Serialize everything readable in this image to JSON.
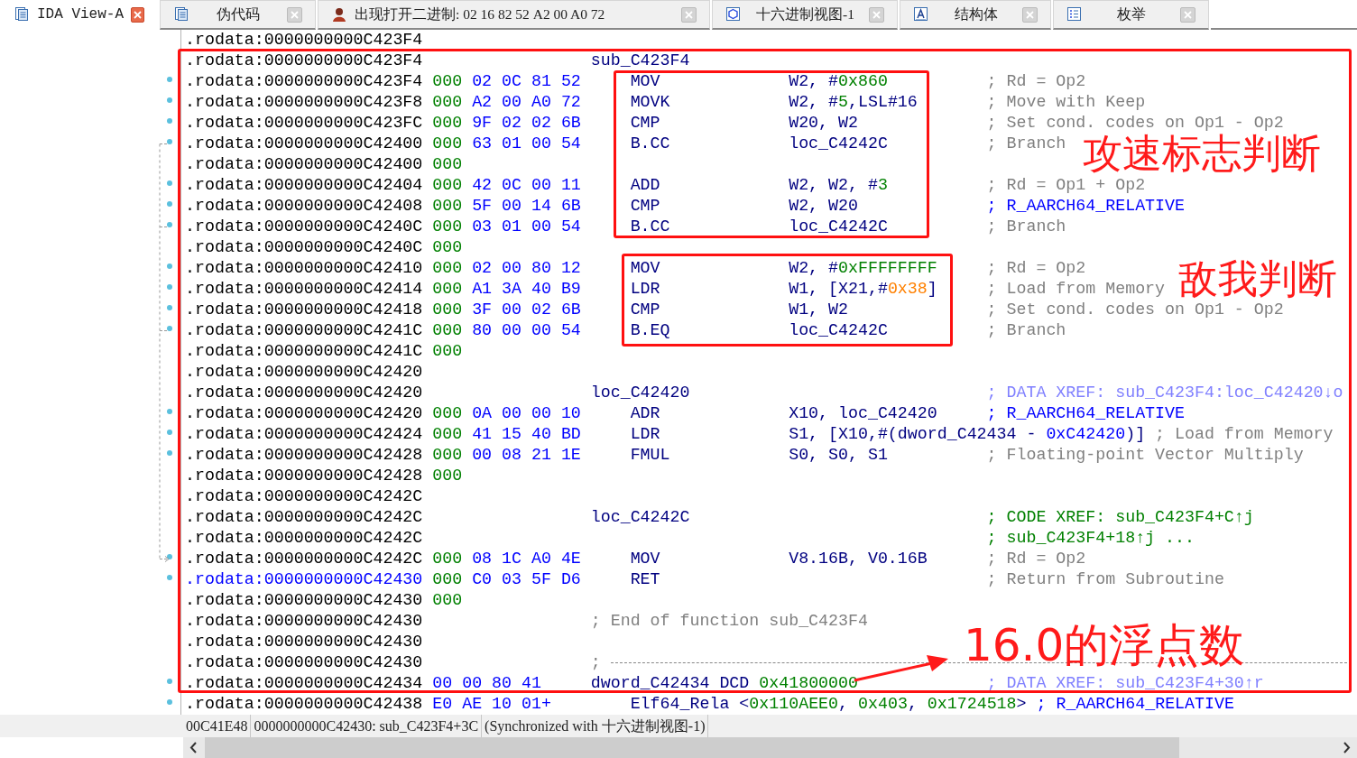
{
  "tabs": [
    {
      "label": "IDA View-A",
      "kind": "listing",
      "selected": true
    },
    {
      "label": "伪代码",
      "kind": "pseudocode",
      "selected": false
    },
    {
      "label": "出现打开二进制: 02 16 82 52 A2 00 A0 72",
      "kind": "custom",
      "selected": false
    },
    {
      "label": "十六进制视图-1",
      "kind": "hex",
      "selected": false
    },
    {
      "label": "结构体",
      "kind": "struct",
      "selected": false
    },
    {
      "label": "枚举",
      "kind": "enum",
      "selected": false
    }
  ],
  "rows": [
    {
      "kind": "addr",
      "addr": ".rodata:0000000000C423F4",
      "marker": false,
      "selected": false
    },
    {
      "kind": "label",
      "addr": ".rodata:0000000000C423F4",
      "label": "sub_C423F4",
      "marker": false,
      "selected": false
    },
    {
      "kind": "insn",
      "addr": ".rodata:0000000000C423F4",
      "prefix": "000",
      "bytes": "02 0C 81 52",
      "mnemonic": "MOV",
      "operands": [
        {
          "text": "W2, #",
          "kind": "reg"
        },
        {
          "text": "0x860",
          "kind": "num"
        }
      ],
      "comment": {
        "text": "; Rd = Op2",
        "kind": "plain"
      },
      "marker": true,
      "selected": false
    },
    {
      "kind": "insn",
      "addr": ".rodata:0000000000C423F8",
      "prefix": "000",
      "bytes": "A2 00 A0 72",
      "mnemonic": "MOVK",
      "operands": [
        {
          "text": "W2, #",
          "kind": "reg"
        },
        {
          "text": "5",
          "kind": "num"
        },
        {
          "text": ",LSL#16",
          "kind": "reg"
        }
      ],
      "comment": {
        "text": "; Move with Keep",
        "kind": "plain"
      },
      "marker": true,
      "selected": false
    },
    {
      "kind": "insn",
      "addr": ".rodata:0000000000C423FC",
      "prefix": "000",
      "bytes": "9F 02 02 6B",
      "mnemonic": "CMP",
      "operands": [
        {
          "text": "W20, W2",
          "kind": "reg"
        }
      ],
      "comment": {
        "text": "; Set cond. codes on Op1 - Op2",
        "kind": "plain"
      },
      "marker": true,
      "selected": false
    },
    {
      "kind": "insn",
      "addr": ".rodata:0000000000C42400",
      "prefix": "000",
      "bytes": "63 01 00 54",
      "mnemonic": "B.CC",
      "operands": [
        {
          "text": "loc_C4242C",
          "kind": "reg"
        }
      ],
      "comment": {
        "text": "; Branch",
        "kind": "plain"
      },
      "marker": true,
      "selected": false
    },
    {
      "kind": "prefix",
      "addr": ".rodata:0000000000C42400",
      "prefix": "000",
      "marker": false,
      "selected": false
    },
    {
      "kind": "insn",
      "addr": ".rodata:0000000000C42404",
      "prefix": "000",
      "bytes": "42 0C 00 11",
      "mnemonic": "ADD",
      "operands": [
        {
          "text": "W2, W2, #",
          "kind": "reg"
        },
        {
          "text": "3",
          "kind": "num"
        }
      ],
      "comment": {
        "text": "; Rd = Op1 + Op2",
        "kind": "plain"
      },
      "marker": true,
      "selected": false
    },
    {
      "kind": "insn",
      "addr": ".rodata:0000000000C42408",
      "prefix": "000",
      "bytes": "5F 00 14 6B",
      "mnemonic": "CMP",
      "operands": [
        {
          "text": "W2, W20",
          "kind": "reg"
        }
      ],
      "comment": {
        "text": "; R_AARCH64_RELATIVE",
        "kind": "reloc"
      },
      "marker": true,
      "selected": false
    },
    {
      "kind": "insn",
      "addr": ".rodata:0000000000C4240C",
      "prefix": "000",
      "bytes": "03 01 00 54",
      "mnemonic": "B.CC",
      "operands": [
        {
          "text": "loc_C4242C",
          "kind": "reg"
        }
      ],
      "comment": {
        "text": "; Branch",
        "kind": "plain"
      },
      "marker": true,
      "selected": false
    },
    {
      "kind": "prefix",
      "addr": ".rodata:0000000000C4240C",
      "prefix": "000",
      "marker": false,
      "selected": false
    },
    {
      "kind": "insn",
      "addr": ".rodata:0000000000C42410",
      "prefix": "000",
      "bytes": "02 00 80 12",
      "mnemonic": "MOV",
      "operands": [
        {
          "text": "W2, #",
          "kind": "reg"
        },
        {
          "text": "0xFFFFFFFF",
          "kind": "num"
        }
      ],
      "comment": {
        "text": "; Rd = Op2",
        "kind": "plain"
      },
      "marker": true,
      "selected": false
    },
    {
      "kind": "insn",
      "addr": ".rodata:0000000000C42414",
      "prefix": "000",
      "bytes": "A1 3A 40 B9",
      "mnemonic": "LDR",
      "operands": [
        {
          "text": "W1, [X21,#",
          "kind": "reg"
        },
        {
          "text": "0x38",
          "kind": "offset"
        },
        {
          "text": "]",
          "kind": "reg"
        }
      ],
      "comment": {
        "text": "; Load from Memory",
        "kind": "plain"
      },
      "marker": true,
      "selected": false
    },
    {
      "kind": "insn",
      "addr": ".rodata:0000000000C42418",
      "prefix": "000",
      "bytes": "3F 00 02 6B",
      "mnemonic": "CMP",
      "operands": [
        {
          "text": "W1, W2",
          "kind": "reg"
        }
      ],
      "comment": {
        "text": "; Set cond. codes on Op1 - Op2",
        "kind": "plain"
      },
      "marker": true,
      "selected": false
    },
    {
      "kind": "insn",
      "addr": ".rodata:0000000000C4241C",
      "prefix": "000",
      "bytes": "80 00 00 54",
      "mnemonic": "B.EQ",
      "operands": [
        {
          "text": "loc_C4242C",
          "kind": "reg"
        }
      ],
      "comment": {
        "text": "; Branch",
        "kind": "plain"
      },
      "marker": true,
      "selected": false
    },
    {
      "kind": "prefix",
      "addr": ".rodata:0000000000C4241C",
      "prefix": "000",
      "marker": false,
      "selected": false
    },
    {
      "kind": "addr",
      "addr": ".rodata:0000000000C42420",
      "marker": false,
      "selected": false
    },
    {
      "kind": "label",
      "addr": ".rodata:0000000000C42420",
      "label": "loc_C42420",
      "comment": {
        "text": "; DATA XREF: sub_C423F4:loc_C42420↓o",
        "kind": "xref"
      },
      "marker": false,
      "selected": false
    },
    {
      "kind": "insn",
      "addr": ".rodata:0000000000C42420",
      "prefix": "000",
      "bytes": "0A 00 00 10",
      "mnemonic": "ADR",
      "operands": [
        {
          "text": "X10, loc_C42420",
          "kind": "reg"
        }
      ],
      "comment": {
        "text": "; R_AARCH64_RELATIVE",
        "kind": "reloc"
      },
      "marker": true,
      "selected": false
    },
    {
      "kind": "insn",
      "addr": ".rodata:0000000000C42424",
      "prefix": "000",
      "bytes": "41 15 40 BD",
      "mnemonic": "LDR",
      "operands": [
        {
          "text": "S1, [X10,#(dword_C42434 - ",
          "kind": "reg"
        },
        {
          "text": "0xC42420",
          "kind": "address"
        },
        {
          "text": ")]",
          "kind": "reg"
        }
      ],
      "comment": {
        "text": "; Load from Memory",
        "kind": "plain"
      },
      "marker": true,
      "selected": false
    },
    {
      "kind": "insn",
      "addr": ".rodata:0000000000C42428",
      "prefix": "000",
      "bytes": "00 08 21 1E",
      "mnemonic": "FMUL",
      "operands": [
        {
          "text": "S0, S0, S1",
          "kind": "reg"
        }
      ],
      "comment": {
        "text": "; Floating-point Vector Multiply",
        "kind": "plain"
      },
      "marker": true,
      "selected": false
    },
    {
      "kind": "prefix",
      "addr": ".rodata:0000000000C42428",
      "prefix": "000",
      "marker": false,
      "selected": false
    },
    {
      "kind": "addr",
      "addr": ".rodata:0000000000C4242C",
      "marker": false,
      "selected": false
    },
    {
      "kind": "label",
      "addr": ".rodata:0000000000C4242C",
      "label": "loc_C4242C",
      "comment": {
        "text": "; CODE XREF: sub_C423F4+C↑j",
        "kind": "code_xref"
      },
      "marker": false,
      "selected": false
    },
    {
      "kind": "label",
      "addr": ".rodata:0000000000C4242C",
      "comment": {
        "text": "; sub_C423F4+18↑j ...",
        "kind": "code_xref"
      },
      "marker": false,
      "selected": false
    },
    {
      "kind": "insn",
      "addr": ".rodata:0000000000C4242C",
      "prefix": "000",
      "bytes": "08 1C A0 4E",
      "mnemonic": "MOV",
      "operands": [
        {
          "text": "V8.16B, V0.16B",
          "kind": "reg"
        }
      ],
      "comment": {
        "text": "; Rd = Op2",
        "kind": "plain"
      },
      "marker": true,
      "selected": false
    },
    {
      "kind": "insn",
      "addr": ".rodata:0000000000C42430",
      "prefix": "000",
      "bytes": "C0 03 5F D6",
      "mnemonic": "RET",
      "comment": {
        "text": "; Return from Subroutine",
        "kind": "plain"
      },
      "marker": true,
      "selected": true
    },
    {
      "kind": "prefix",
      "addr": ".rodata:0000000000C42430",
      "prefix": "000",
      "marker": false,
      "selected": false
    },
    {
      "kind": "note",
      "addr": ".rodata:0000000000C42430",
      "comment": {
        "text": "; End of function sub_C423F4",
        "kind": "plain"
      },
      "marker": false,
      "selected": false
    },
    {
      "kind": "addr",
      "addr": ".rodata:0000000000C42430",
      "marker": false,
      "selected": false
    },
    {
      "kind": "separator",
      "addr": ".rodata:0000000000C42430",
      "comment": {
        "text": ";",
        "kind": "plain"
      },
      "marker": false,
      "selected": false
    },
    {
      "kind": "data",
      "addr": ".rodata:0000000000C42434",
      "bytes": "00 00 80 41",
      "label": "dword_C42434 DCD",
      "operands": [
        {
          "text": "0x41800000",
          "kind": "num"
        }
      ],
      "comment": {
        "text": "; DATA XREF: sub_C423F4+30↑r",
        "kind": "xref"
      },
      "marker": true,
      "selected": false
    },
    {
      "kind": "struct",
      "addr": ".rodata:0000000000C42438",
      "bytes": "E0 AE 10 01+",
      "mnemonic": "Elf64_Rela",
      "operands": [
        {
          "text": "<",
          "kind": "reg"
        },
        {
          "text": "0x110AEE0",
          "kind": "num"
        },
        {
          "text": ", ",
          "kind": "reg"
        },
        {
          "text": "0x403",
          "kind": "num"
        },
        {
          "text": ", ",
          "kind": "reg"
        },
        {
          "text": "0x1724518",
          "kind": "num"
        },
        {
          "text": ">",
          "kind": "reg"
        }
      ],
      "comment": {
        "text": "; R_AARCH64_RELATIVE",
        "kind": "reloc"
      },
      "marker": true,
      "selected": false
    }
  ],
  "status_bar": [
    "00C41E48",
    "0000000000C42430: sub_C423F4+3C",
    "(Synchronized with 十六进制视图-1)"
  ],
  "annotations": [
    "攻速标志判断",
    "敌我判断",
    "16.0的浮点数"
  ]
}
